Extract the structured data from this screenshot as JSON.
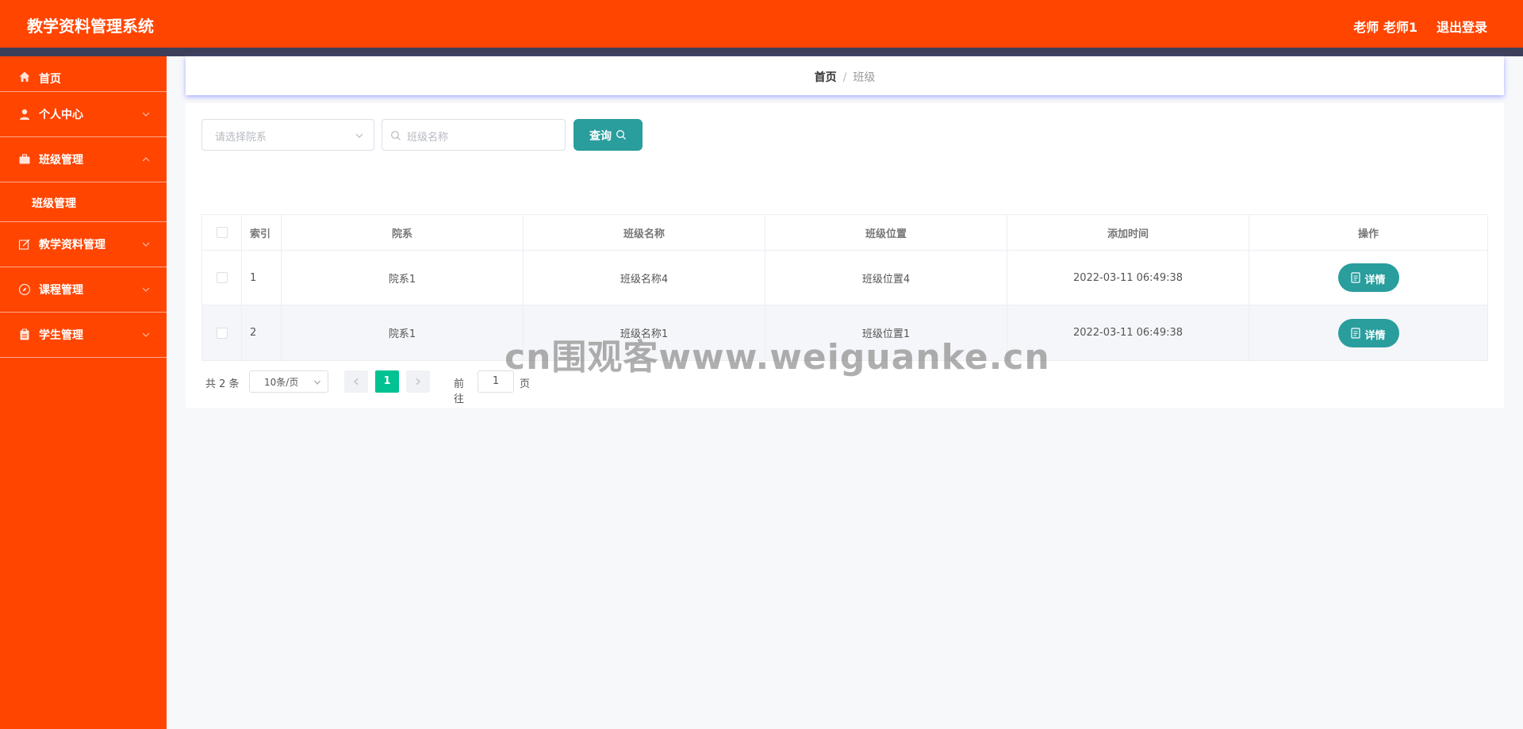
{
  "header": {
    "title": "教学资料管理系统",
    "user": "老师 老师1",
    "logout": "退出登录"
  },
  "sidebar": {
    "items": [
      {
        "label": "首页",
        "icon": "home-icon"
      },
      {
        "label": "个人中心",
        "icon": "user-icon"
      },
      {
        "label": "班级管理",
        "icon": "briefcase-icon",
        "expanded": true
      },
      {
        "label": "班级管理"
      },
      {
        "label": "教学资料管理",
        "icon": "edit-icon"
      },
      {
        "label": "课程管理",
        "icon": "compass-icon"
      },
      {
        "label": "学生管理",
        "icon": "clipboard-icon"
      }
    ]
  },
  "breadcrumb": {
    "home": "首页",
    "sep": "/",
    "current": "班级"
  },
  "filters": {
    "dept_placeholder": "请选择院系",
    "name_placeholder": "班级名称",
    "query_label": "查询"
  },
  "table": {
    "columns": [
      "索引",
      "院系",
      "班级名称",
      "班级位置",
      "添加时间",
      "操作"
    ],
    "rows": [
      {
        "index": "1",
        "dept": "院系1",
        "name": "班级名称4",
        "location": "班级位置4",
        "time": "2022-03-11 06:49:38",
        "action": "详情"
      },
      {
        "index": "2",
        "dept": "院系1",
        "name": "班级名称1",
        "location": "班级位置1",
        "time": "2022-03-11 06:49:38",
        "action": "详情"
      }
    ]
  },
  "pagination": {
    "total": "共 2 条",
    "page_size": "10条/页",
    "current_page": "1",
    "goto_label": "前往",
    "goto_value": "1",
    "page_unit": "页"
  },
  "watermark": "cn围观客www.weiguanke.cn",
  "colors": {
    "header": "#ff4500",
    "sidebar": "#ff4500",
    "header_strip": "#3d3f5a",
    "button": "#2a9d9d",
    "active_page": "#00c292"
  }
}
